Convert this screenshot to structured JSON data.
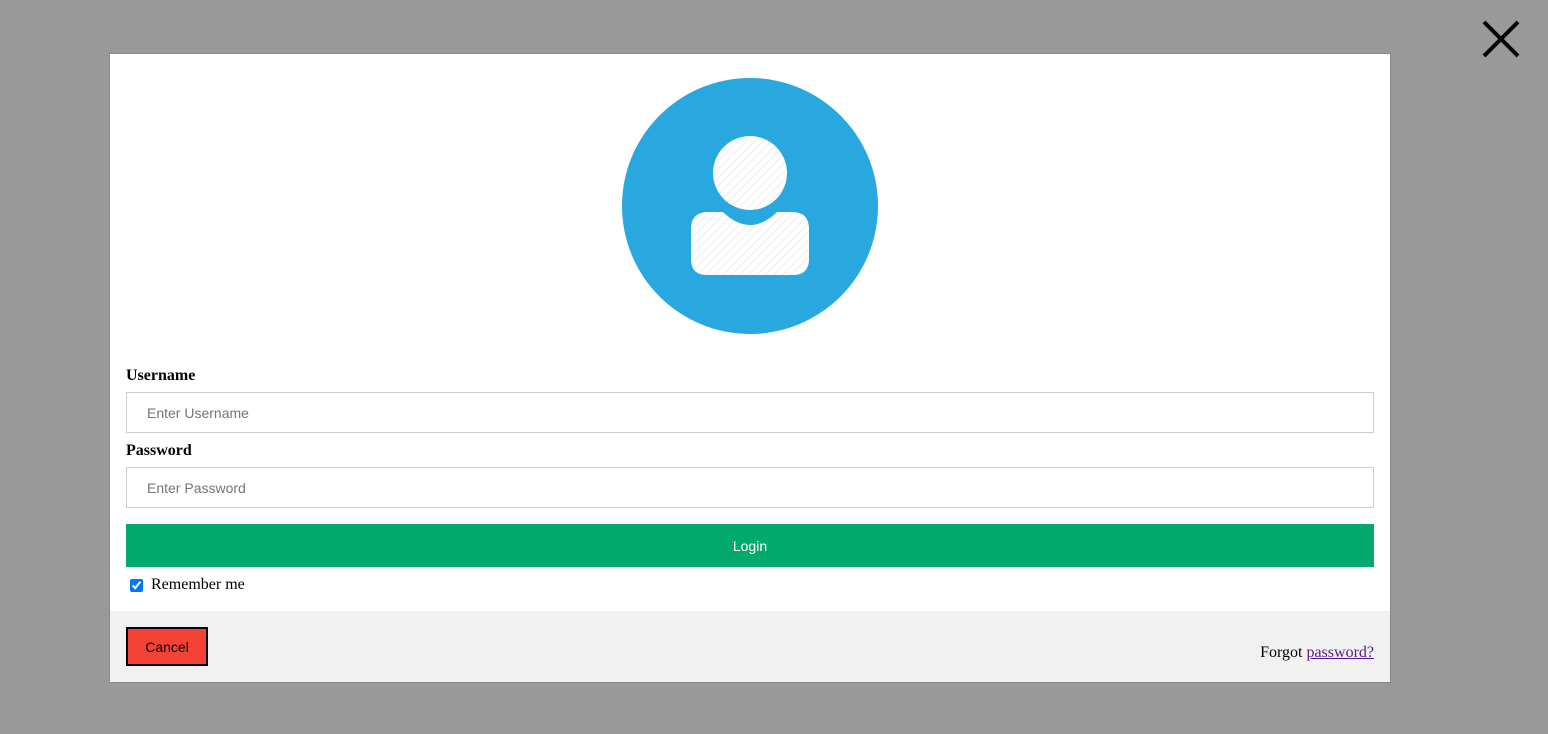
{
  "colors": {
    "overlay": "#999999",
    "avatar_bg": "#29a8e0",
    "login_button": "#04aa6d",
    "cancel_button": "#f44336",
    "link_visited": "#551a8b"
  },
  "icons": {
    "close": "close-icon",
    "avatar": "user-avatar-icon"
  },
  "form": {
    "username_label": "Username",
    "username_placeholder": "Enter Username",
    "password_label": "Password",
    "password_placeholder": "Enter Password",
    "login_label": "Login",
    "remember_label": "Remember me",
    "remember_checked": true
  },
  "footer": {
    "cancel_label": "Cancel",
    "forgot_text": "Forgot",
    "forgot_link": "password?"
  }
}
